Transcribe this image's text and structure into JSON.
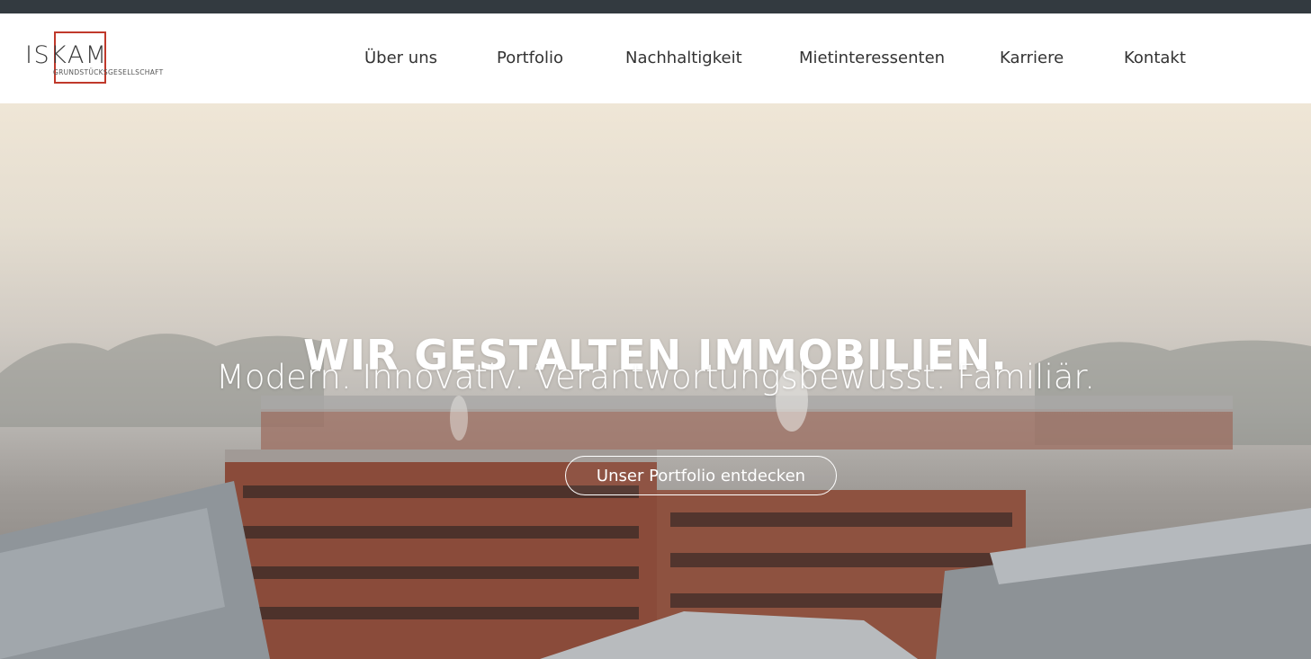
{
  "logo": {
    "word": "ISKAM",
    "subtitle": "GRUNDSTÜCKSGESELLSCHAFT",
    "accent_color": "#c0392b"
  },
  "nav": {
    "items": [
      {
        "label": "Über uns"
      },
      {
        "label": "Portfolio"
      },
      {
        "label": "Nachhaltigkeit"
      },
      {
        "label": "Mietinteressenten"
      },
      {
        "label": "Karriere"
      },
      {
        "label": "Kontakt"
      }
    ]
  },
  "hero": {
    "title": "WIR GESTALTEN IMMOBILIEN.",
    "subtitle": "Modern. Innovativ. Verantwortungsbewusst. Familiär.",
    "cta_label": "Unser Portfolio entdecken"
  },
  "colors": {
    "topbar": "#333a40",
    "brick": "#8a4b3a",
    "text": "#333333"
  }
}
